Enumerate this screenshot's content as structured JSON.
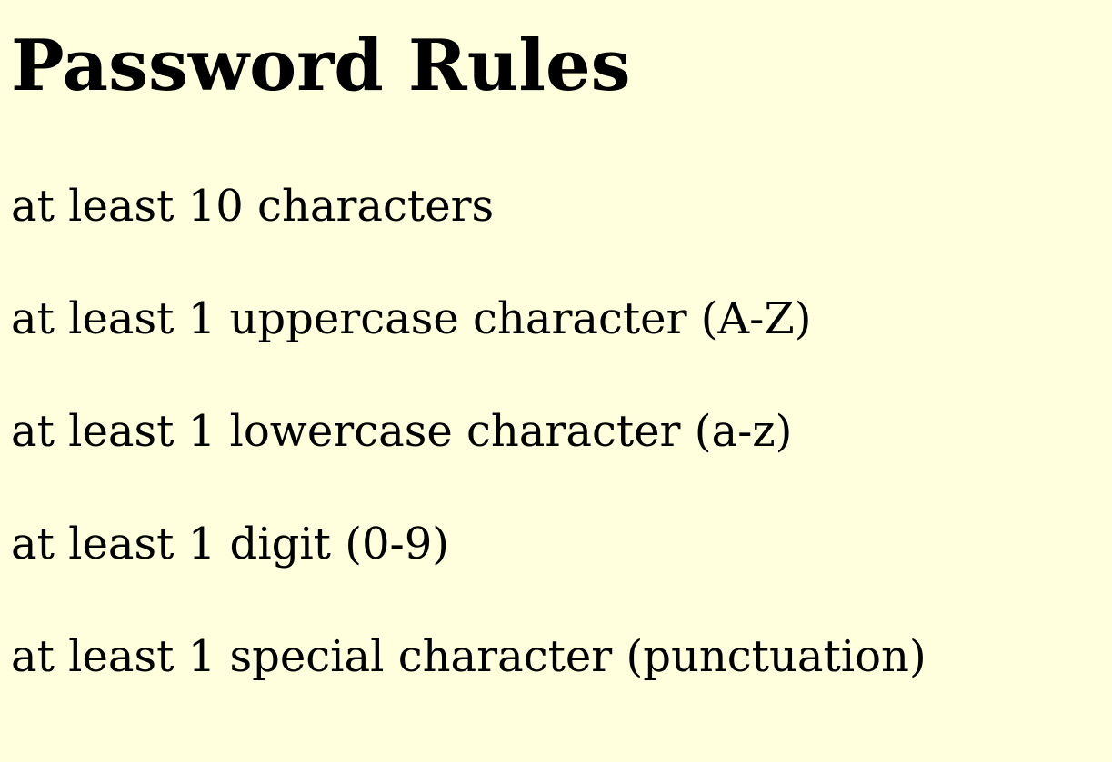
{
  "page": {
    "title": "Password Rules",
    "rules": [
      "at least 10 characters",
      "at least 1 uppercase character (A-Z)",
      "at least 1 lowercase character (a-z)",
      "at least 1 digit (0-9)",
      "at least 1 special character (punctuation)"
    ]
  },
  "colors": {
    "background": "#ffffdd",
    "text": "#000000"
  }
}
